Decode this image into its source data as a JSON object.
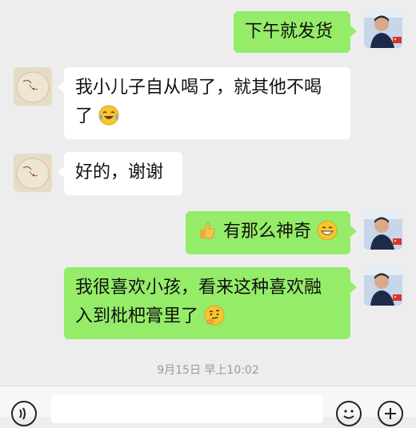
{
  "messages": [
    {
      "side": "out",
      "text": "下午就发货"
    },
    {
      "side": "in",
      "text": "我小儿子自从喝了，就其他不喝了",
      "emoji": "laugh-cry-icon"
    },
    {
      "side": "in",
      "text": "好的，谢谢"
    },
    {
      "side": "out",
      "text": "有那么神奇",
      "emoji_before": "thumbs-up-icon",
      "emoji": "grin-icon"
    },
    {
      "side": "out",
      "text": "我很喜欢小孩，看来这种喜欢融入到枇杷膏里了",
      "emoji": "thinking-icon"
    }
  ],
  "m2_line1": "我小儿子自从喝了，就其他不喝",
  "m2_line2": "了",
  "m5_line1": "我很喜欢小孩，看来这种喜欢融",
  "m5_line2": "入到枇杷膏里了",
  "timestamp": "9月15日 早上10:02",
  "input_bar": {
    "voice_icon": "voice-icon",
    "emoji_icon": "emoji-icon",
    "plus_icon": "plus-icon"
  },
  "colors": {
    "background": "#ededed",
    "outgoing_bubble": "#95ec69",
    "incoming_bubble": "#ffffff",
    "timestamp_text": "#9a9a9a"
  }
}
